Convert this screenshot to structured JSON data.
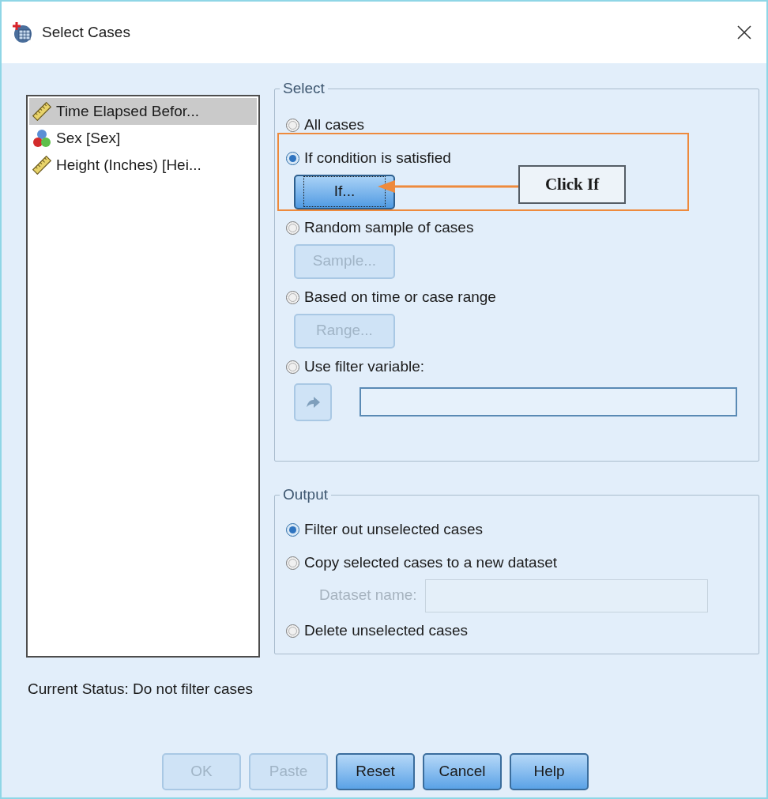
{
  "window": {
    "title": "Select Cases"
  },
  "variables": [
    {
      "label": "Time Elapsed Befor...",
      "kind": "scale",
      "selected": true
    },
    {
      "label": "Sex [Sex]",
      "kind": "nominal",
      "selected": false
    },
    {
      "label": "Height (Inches) [Hei...",
      "kind": "scale",
      "selected": false
    }
  ],
  "select": {
    "title": "Select",
    "options": [
      {
        "kind": "plain",
        "label": "All cases",
        "selected": false
      },
      {
        "kind": "button",
        "label": "If condition is satisfied",
        "selected": true,
        "button": {
          "label": "If...",
          "disabled": false,
          "focused": true
        }
      },
      {
        "kind": "button",
        "label": "Random sample of cases",
        "selected": false,
        "button": {
          "label": "Sample...",
          "disabled": true,
          "focused": false
        }
      },
      {
        "kind": "button",
        "label": "Based on time or case range",
        "selected": false,
        "button": {
          "label": "Range...",
          "disabled": true,
          "focused": false
        }
      },
      {
        "kind": "variable",
        "label": "Use filter variable:",
        "selected": false
      }
    ]
  },
  "output": {
    "title": "Output",
    "options": [
      {
        "kind": "plain",
        "label": "Filter out unselected cases",
        "selected": true
      },
      {
        "kind": "dataset",
        "label": "Copy selected cases to a new dataset",
        "selected": false,
        "field": {
          "label": "Dataset name:",
          "disabled": true
        }
      },
      {
        "kind": "plain",
        "label": "Delete unselected cases",
        "selected": false
      }
    ]
  },
  "status": "Current Status: Do not filter cases",
  "buttons": [
    {
      "label": "OK",
      "disabled": true
    },
    {
      "label": "Paste",
      "disabled": true
    },
    {
      "label": "Reset",
      "disabled": false
    },
    {
      "label": "Cancel",
      "disabled": false
    },
    {
      "label": "Help",
      "disabled": false
    }
  ],
  "annotation": {
    "label": "Click If"
  }
}
